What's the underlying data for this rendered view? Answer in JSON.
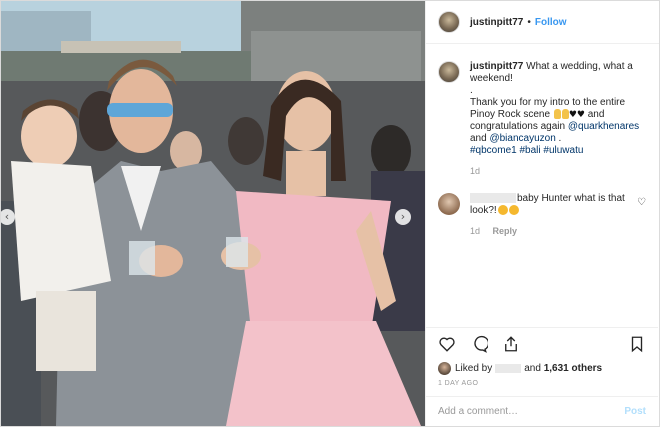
{
  "header": {
    "username": "justinpitt77",
    "separator": "•",
    "follow_label": "Follow"
  },
  "caption": {
    "username": "justinpitt77",
    "line1": "What a wedding, what a weekend!",
    "dot_line": ".",
    "line2": "Thank you for my intro to the entire Pinoy Rock scene",
    "line2b": "and congratulations again",
    "mention1": "@quarkhenares",
    "and_word": "and",
    "mention2": "@biancayuzon",
    "period": " .",
    "hashtags": "#qbcome1 #bali #uluwatu",
    "time": "1d"
  },
  "comment": {
    "text": "baby Hunter what is that look?!",
    "time": "1d",
    "reply_label": "Reply"
  },
  "actions": {
    "liked_by_prefix": "Liked by",
    "liked_by_suffix": "and",
    "likes_count": "1,631 others",
    "time_ago": "1 DAY AGO"
  },
  "add_comment": {
    "placeholder": "Add a comment…",
    "post_label": "Post"
  },
  "colors": {
    "link_blue": "#3897f0",
    "mention_blue": "#003569",
    "muted": "#999999",
    "text": "#262626"
  }
}
